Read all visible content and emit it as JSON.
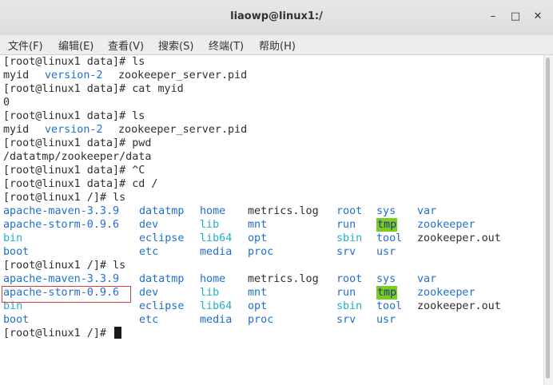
{
  "window": {
    "title": "liaowp@linux1:/",
    "minimize": "–",
    "maximize": "□",
    "close": "✕"
  },
  "menu": [
    "文件(F)",
    "编辑(E)",
    "查看(V)",
    "搜索(S)",
    "终端(T)",
    "帮助(H)"
  ],
  "terminal": {
    "lines": [
      "[root@linux1 data]# ls",
      "myid  version-2  zookeeper_server.pid",
      "[root@linux1 data]# cat myid",
      "0",
      "[root@linux1 data]# ls",
      "myid  version-2  zookeeper_server.pid",
      "[root@linux1 data]# pwd",
      "/datatmp/zookeeper/data",
      "[root@linux1 data]# ^C",
      "[root@linux1 data]# cd /",
      "[root@linux1 /]# ls",
      "[root@linux1 /]# ls",
      "[root@linux1 /]# "
    ],
    "ls_output": {
      "row1": [
        "apache-maven-3.3.9",
        "datatmp",
        "home",
        "metrics.log",
        "root",
        "sys",
        "var"
      ],
      "row2": [
        "apache-storm-0.9.6",
        "dev",
        "lib",
        "mnt",
        "run",
        "tmp",
        "zookeeper"
      ],
      "row3": [
        "bin",
        "eclipse",
        "lib64",
        "opt",
        "sbin",
        "tool",
        "zookeeper.out"
      ],
      "row4": [
        "boot",
        "etc",
        "media",
        "proc",
        "srv",
        "usr"
      ]
    }
  },
  "colors": {
    "directory": "#1f6fd0",
    "symlink": "#1fb0c8",
    "tmp_background": "#7acc1f",
    "highlight_border": "#e23a3a"
  }
}
